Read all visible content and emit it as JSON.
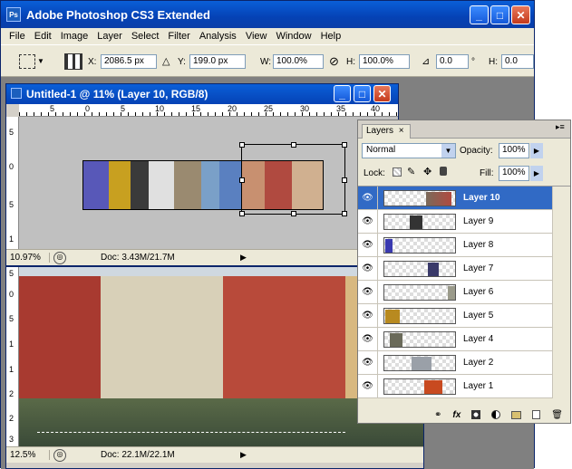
{
  "app": {
    "title": "Adobe Photoshop CS3 Extended",
    "icon_text": "Ps",
    "window_buttons": {
      "minimize": "_",
      "maximize": "□",
      "close": "✕"
    }
  },
  "menu": [
    "File",
    "Edit",
    "Image",
    "Layer",
    "Select",
    "Filter",
    "Analysis",
    "View",
    "Window",
    "Help"
  ],
  "options_bar": {
    "x_label": "X:",
    "x_value": "2086.5 px",
    "y_label": "Y:",
    "y_value": "199.0 px",
    "w_label": "W:",
    "w_value": "100.0%",
    "h_label": "H:",
    "h_value": "100.0%",
    "angle_value": "0.0",
    "angle_unit": "°",
    "hskew_label": "H:",
    "hskew_value": "0.0"
  },
  "doc1": {
    "title": "Untitled-1 @ 11% (Layer 10, RGB/8)",
    "zoom": "10.97%",
    "doc_size": "Doc: 3.43M/21.7M",
    "ruler_h": [
      "5",
      "0",
      "5",
      "10",
      "15",
      "20",
      "25",
      "30",
      "35",
      "40"
    ],
    "ruler_v": [
      "5",
      "0",
      "5",
      "1"
    ]
  },
  "doc2": {
    "zoom": "12.5%",
    "doc_size": "Doc: 22.1M/22.1M",
    "ruler_v": [
      "5",
      "0",
      "5",
      "1",
      "1",
      "2",
      "2",
      "3"
    ]
  },
  "layers_panel": {
    "tab": "Layers",
    "tab_close": "×",
    "blend_mode": "Normal",
    "opacity_label": "Opacity:",
    "opacity_value": "100%",
    "lock_label": "Lock:",
    "fill_label": "Fill:",
    "fill_value": "100%",
    "layers": [
      {
        "name": "Layer 10",
        "selected": true
      },
      {
        "name": "Layer 9",
        "selected": false
      },
      {
        "name": "Layer 8",
        "selected": false
      },
      {
        "name": "Layer 7",
        "selected": false
      },
      {
        "name": "Layer 6",
        "selected": false
      },
      {
        "name": "Layer 5",
        "selected": false
      },
      {
        "name": "Layer 4",
        "selected": false
      },
      {
        "name": "Layer 2",
        "selected": false
      },
      {
        "name": "Layer 1",
        "selected": false
      }
    ],
    "footer_icons": [
      "link-icon",
      "fx-icon",
      "mask-icon",
      "adjustment-icon",
      "folder-icon",
      "new-layer-icon",
      "trash-icon"
    ]
  },
  "colors": {
    "xp_blue": "#0542b5",
    "selection": "#316ac5",
    "panel": "#ece9d8"
  }
}
